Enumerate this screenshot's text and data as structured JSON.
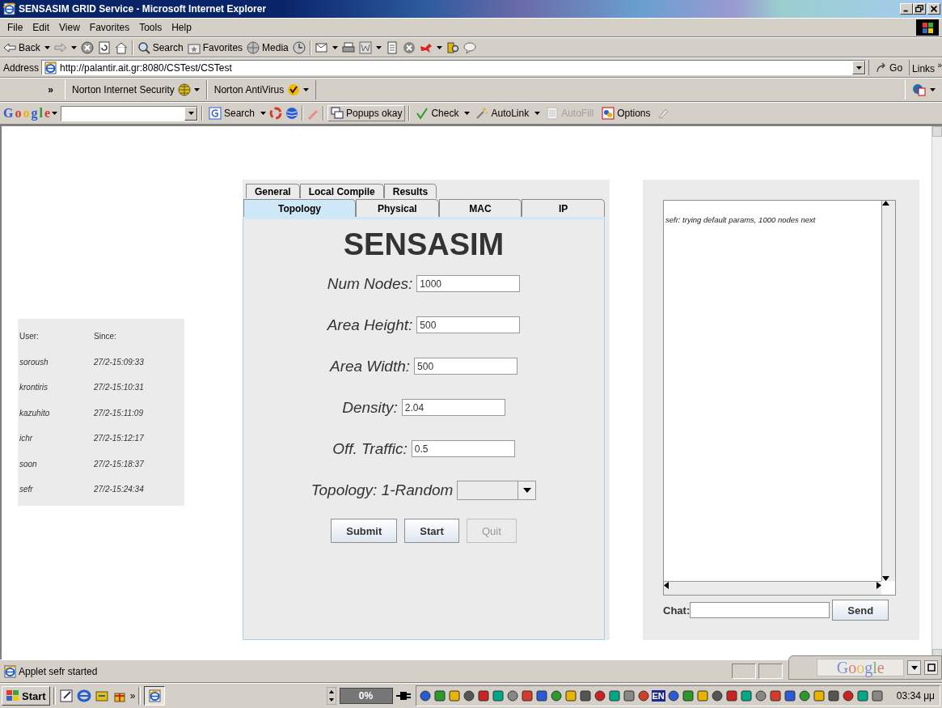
{
  "window": {
    "title": "SENSASIM GRID Service - Microsoft Internet Explorer"
  },
  "menu": [
    "File",
    "Edit",
    "View",
    "Favorites",
    "Tools",
    "Help"
  ],
  "toolbar": {
    "back": "Back",
    "buttons": [
      "Search",
      "Favorites",
      "Media"
    ]
  },
  "address_bar": {
    "label": "Address",
    "url": "http://palantir.ait.gr:8080/CSTest/CSTest",
    "go": "Go",
    "links": "Links",
    "links_chevron": "»"
  },
  "norton_bar": {
    "chevron": "»",
    "items": [
      "Norton Internet Security",
      "Norton AntiVirus"
    ]
  },
  "google_bar": {
    "logo": "Google",
    "buttons": [
      {
        "label": "Search",
        "disabled": false
      },
      {
        "label": "Popups okay",
        "disabled": false
      },
      {
        "label": "Check",
        "disabled": false
      },
      {
        "label": "AutoLink",
        "disabled": false
      },
      {
        "label": "AutoFill",
        "disabled": true
      },
      {
        "label": "Options",
        "disabled": false
      }
    ]
  },
  "user_table": {
    "columns": [
      "User:",
      "Since:"
    ],
    "rows": [
      [
        "soroush",
        "27/2-15:09:33"
      ],
      [
        "krontiris",
        "27/2-15:10:31"
      ],
      [
        "kazuhito",
        "27/2-15:11:09"
      ],
      [
        "ichr",
        "27/2-15:12:17"
      ],
      [
        "soon",
        "27/2-15:18:37"
      ],
      [
        "sefr",
        "27/2-15:24:34"
      ]
    ]
  },
  "applet": {
    "tab_rows": [
      [
        {
          "label": "General",
          "selected": false
        },
        {
          "label": "Local Compile",
          "selected": false
        },
        {
          "label": "Results",
          "selected": false
        }
      ],
      [
        {
          "label": "Topology",
          "selected": true
        },
        {
          "label": "Physical",
          "selected": false
        },
        {
          "label": "MAC",
          "selected": false
        },
        {
          "label": "IP",
          "selected": false
        }
      ]
    ],
    "title": "SENSASIM",
    "fields": [
      {
        "label": "Num Nodes:",
        "value": "1000"
      },
      {
        "label": "Area Height:",
        "value": "500"
      },
      {
        "label": "Area Width:",
        "value": "500"
      },
      {
        "label": "Density:",
        "value": "2.04"
      },
      {
        "label": "Off. Traffic:",
        "value": "0.5"
      }
    ],
    "topology": {
      "label": "Topology: 1-Random"
    },
    "buttons": [
      {
        "label": "Submit",
        "disabled": false
      },
      {
        "label": "Start",
        "disabled": false
      },
      {
        "label": "Quit",
        "disabled": true
      }
    ]
  },
  "chat": {
    "messages": [
      "sefr: trying default params, 1000 nodes next"
    ],
    "label": "Chat:",
    "send": "Send"
  },
  "status_bar": {
    "text": "Applet sefr started"
  },
  "deskbar": {
    "logo": "Google"
  },
  "taskbar": {
    "start": "Start",
    "chevron": "»",
    "battery": "0%",
    "language": "EN",
    "clock": "03:34 μμ"
  }
}
